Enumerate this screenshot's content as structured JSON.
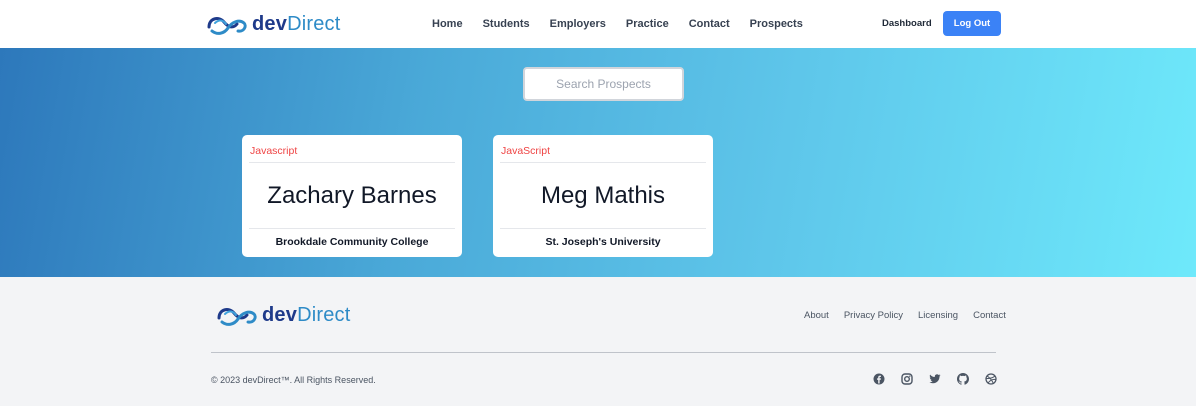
{
  "brand": {
    "name_part1": "dev",
    "name_part2": "Direct"
  },
  "nav": {
    "items": [
      "Home",
      "Students",
      "Employers",
      "Practice",
      "Contact",
      "Prospects"
    ]
  },
  "header": {
    "dashboard_label": "Dashboard",
    "logout_label": "Log Out"
  },
  "search": {
    "placeholder": "Search Prospects",
    "value": ""
  },
  "prospects": [
    {
      "language": "Javascript",
      "name": "Zachary Barnes",
      "school": "Brookdale Community College"
    },
    {
      "language": "JavaScript",
      "name": "Meg Mathis",
      "school": "St. Joseph's University"
    }
  ],
  "footer": {
    "links": [
      "About",
      "Privacy Policy",
      "Licensing",
      "Contact"
    ],
    "copyright": "© 2023 devDirect™. All Rights Reserved.",
    "social_icons": [
      "facebook-icon",
      "instagram-icon",
      "twitter-icon",
      "github-icon",
      "dribbble-icon"
    ]
  },
  "colors": {
    "accent": "#3b82f6",
    "brand_dark": "#1e3a8a",
    "brand_light": "#2e8bc7",
    "language_tag": "#ef4444"
  }
}
